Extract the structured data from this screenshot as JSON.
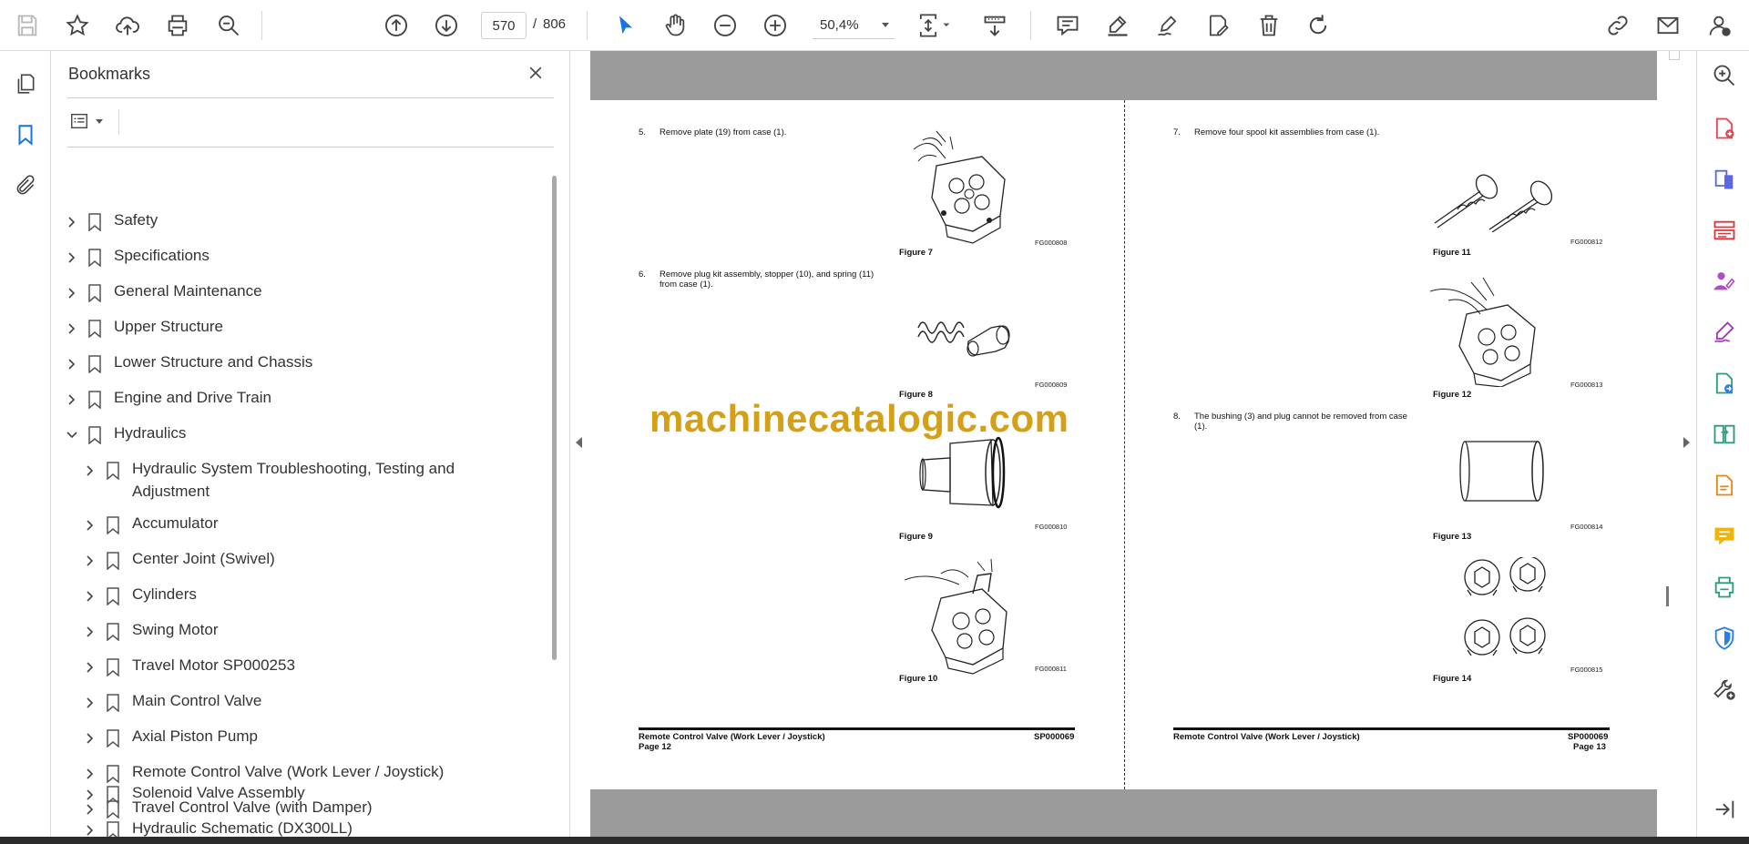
{
  "toolbar": {
    "page_current": "570",
    "page_separator": "/",
    "page_total": "806",
    "zoom": "50,4%",
    "icons": [
      "save-icon",
      "star-icon",
      "upload-icon",
      "print-icon",
      "search-icon",
      "page-up-icon",
      "page-down-icon",
      "select-cursor-icon",
      "hand-icon",
      "zoom-out-icon",
      "zoom-in-icon",
      "fit-page-icon",
      "scroll-mode-icon",
      "comment-icon",
      "highlight-icon",
      "sign-icon",
      "edit-pdf-icon",
      "delete-icon",
      "rotate-icon",
      "share-link-icon",
      "email-icon",
      "account-icon"
    ]
  },
  "bookmarks": {
    "title": "Bookmarks",
    "items": [
      {
        "label": "Safety",
        "level": 0,
        "expanded": false
      },
      {
        "label": "Specifications",
        "level": 0,
        "expanded": false
      },
      {
        "label": "General Maintenance",
        "level": 0,
        "expanded": false
      },
      {
        "label": "Upper Structure",
        "level": 0,
        "expanded": false
      },
      {
        "label": "Lower Structure and Chassis",
        "level": 0,
        "expanded": false
      },
      {
        "label": "Engine and Drive Train",
        "level": 0,
        "expanded": false
      },
      {
        "label": "Hydraulics",
        "level": 0,
        "expanded": true
      },
      {
        "label": "Hydraulic System Troubleshooting, Testing and",
        "label2": "Adjustment",
        "level": 1,
        "expanded": false
      },
      {
        "label": "Accumulator",
        "level": 1,
        "expanded": false
      },
      {
        "label": "Center Joint (Swivel)",
        "level": 1,
        "expanded": false
      },
      {
        "label": "Cylinders",
        "level": 1,
        "expanded": false
      },
      {
        "label": "Swing Motor",
        "level": 1,
        "expanded": false
      },
      {
        "label": "Travel Motor SP000253",
        "level": 1,
        "expanded": false
      },
      {
        "label": "Main Control Valve",
        "level": 1,
        "expanded": false
      },
      {
        "label": "Axial Piston Pump",
        "level": 1,
        "expanded": false
      },
      {
        "label": "Remote Control Valve (Work Lever / Joystick)",
        "level": 1,
        "expanded": false
      },
      {
        "label": "Travel Control Valve (with Damper)",
        "level": 1,
        "expanded": false
      },
      {
        "label": "Solenoid Valve Assembly",
        "level": 1,
        "expanded": false
      },
      {
        "label": "Hydraulic Schematic (DX300LL)",
        "level": 1,
        "expanded": false
      }
    ]
  },
  "document": {
    "watermark": "machinecatalogic.com",
    "left_page": {
      "steps": [
        {
          "num": "5.",
          "text": "Remove plate (19) from case (1)."
        },
        {
          "num": "6.",
          "text": "Remove plug kit assembly, stopper (10), and spring (11)",
          "text2": "from case (1)."
        }
      ],
      "figures": [
        {
          "caption": "Figure 7",
          "code": "FG000808"
        },
        {
          "caption": "Figure 8",
          "code": "FG000809"
        },
        {
          "caption": "Figure 9",
          "code": "FG000810"
        },
        {
          "caption": "Figure 10",
          "code": "FG000811"
        }
      ],
      "footer_title": "Remote Control Valve (Work Lever / Joystick)",
      "footer_page": "Page 12",
      "footer_code": "SP000069"
    },
    "right_page": {
      "steps": [
        {
          "num": "7.",
          "text": "Remove four spool kit assemblies from case (1)."
        },
        {
          "num": "8.",
          "text": "The bushing (3) and plug cannot be removed from case",
          "text2": "(1)."
        }
      ],
      "figures": [
        {
          "caption": "Figure 11",
          "code": "FG000812"
        },
        {
          "caption": "Figure 12",
          "code": "FG000813"
        },
        {
          "caption": "Figure 13",
          "code": "FG000814"
        },
        {
          "caption": "Figure 14",
          "code": "FG000815"
        }
      ],
      "footer_title": "Remote Control Valve (Work Lever / Joystick)",
      "footer_page": "Page 13",
      "footer_code": "SP000069"
    }
  },
  "right_rail": {
    "icons": [
      "zoom-search-icon",
      "create-pdf-icon",
      "export-pdf-icon",
      "organize-pages-icon",
      "request-signatures-icon",
      "fill-sign-icon",
      "export-file-icon",
      "compare-icon",
      "edit-pdf-icon",
      "comment-icon",
      "print-production-icon",
      "protect-icon",
      "more-tools-icon",
      "collapse-pane-icon"
    ]
  }
}
